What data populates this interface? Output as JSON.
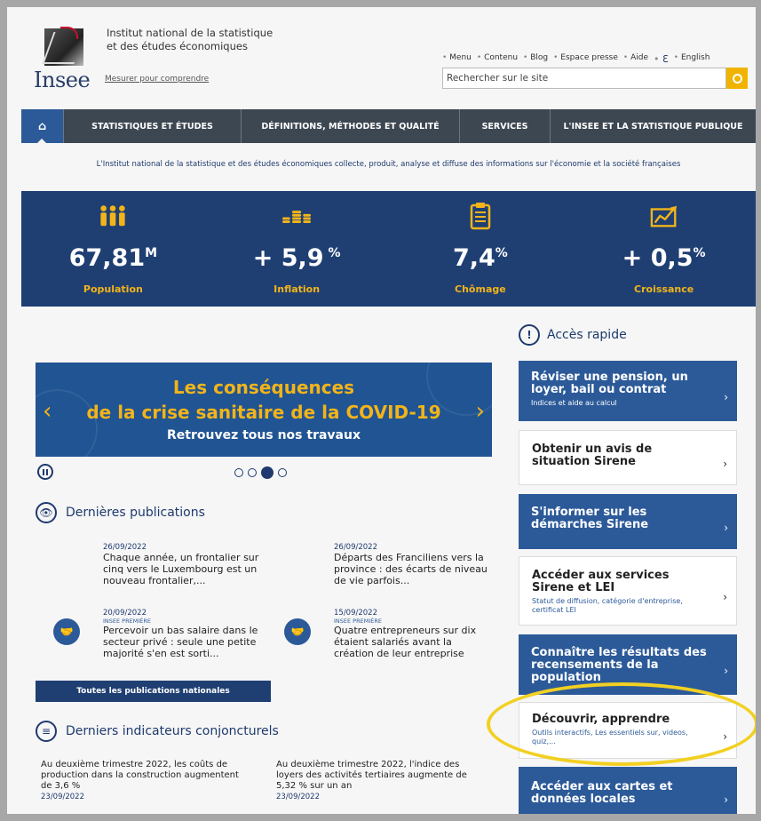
{
  "header": {
    "logo_text": "Insee",
    "institute_name": "Institut national de la statistique et des études économiques",
    "tagline": "Mesurer pour comprendre",
    "top_links": [
      "Menu",
      "Contenu",
      "Blog",
      "Espace presse",
      "Aide",
      "English"
    ],
    "search_placeholder": "Rechercher sur le site"
  },
  "nav": {
    "items": [
      "STATISTIQUES ET ÉTUDES",
      "DÉFINITIONS, MÉTHODES ET QUALITÉ",
      "SERVICES",
      "L'INSEE ET LA STATISTIQUE PUBLIQUE"
    ]
  },
  "intro": "L'Institut national de la statistique et des études économiques collecte, produit, analyse et diffuse des informations sur l'économie et la société françaises",
  "stats": [
    {
      "value": "67,81",
      "suffix": "M",
      "label": "Population"
    },
    {
      "value": "+ 5,9",
      "suffix": " %",
      "label": "Inflation"
    },
    {
      "value": "7,4",
      "suffix": "%",
      "label": "Chômage"
    },
    {
      "value": "+ 0,5",
      "suffix": "%",
      "label": "Croissance"
    }
  ],
  "banner": {
    "line1": "Les conséquences",
    "line2": "de la crise sanitaire de la COVID-19",
    "line3": "Retrouvez tous nos travaux"
  },
  "publications": {
    "title": "Dernières publications",
    "items": [
      {
        "date": "26/09/2022",
        "category": "",
        "text": "Chaque année, un frontalier sur cinq vers le Luxembourg est un nouveau frontalier,..."
      },
      {
        "date": "26/09/2022",
        "category": "",
        "text": "Départs des Franciliens vers la province : des écarts de niveau de vie parfois..."
      },
      {
        "date": "20/09/2022",
        "category": "INSEE PREMIÈRE",
        "text": "Percevoir un bas salaire dans le secteur privé : seule une petite majorité s'en est sorti..."
      },
      {
        "date": "15/09/2022",
        "category": "INSEE PREMIÈRE",
        "text": "Quatre entrepreneurs sur dix étaient salariés avant la création de leur entreprise"
      }
    ],
    "all_button": "Toutes les publications nationales"
  },
  "indicators": {
    "title": "Derniers indicateurs conjoncturels",
    "items": [
      {
        "text": "Au deuxième trimestre 2022, les coûts de production dans la construction augmentent de 3,6 %",
        "date": "23/09/2022"
      },
      {
        "text": "Au deuxième trimestre 2022, l'indice des loyers des activités tertiaires augmente de 5,32 % sur un an",
        "date": "23/09/2022"
      }
    ]
  },
  "quick_access": {
    "title": "Accès rapide",
    "items": [
      {
        "title": "Réviser une pension, un loyer, bail ou contrat",
        "sub": "Indices et aide au calcul",
        "style": "blue"
      },
      {
        "title": "Obtenir un avis de situation Sirene",
        "sub": "",
        "style": "white"
      },
      {
        "title": "S'informer sur les démarches Sirene",
        "sub": "",
        "style": "blue"
      },
      {
        "title": "Accéder aux services Sirene et LEI",
        "sub": "Statut de diffusion, catégorie d'entreprise, certificat LEI",
        "style": "white"
      },
      {
        "title": "Connaître les résultats des recensements de la population",
        "sub": "",
        "style": "blue"
      },
      {
        "title": "Découvrir, apprendre",
        "sub": "Outils interactifs, Les essentiels sur, videos, quiz,...",
        "style": "white"
      },
      {
        "title": "Accéder aux cartes et données locales",
        "sub": "",
        "style": "blue"
      }
    ]
  },
  "colors": {
    "brand_blue": "#1f3f73",
    "accent_yellow": "#f2b41a",
    "nav_gray": "#3d4752",
    "highlight": "#f2d022"
  }
}
